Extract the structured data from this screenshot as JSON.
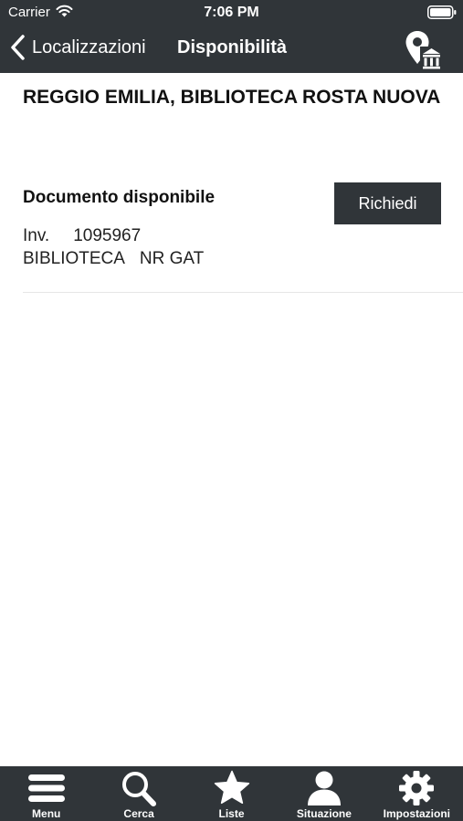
{
  "status_bar": {
    "carrier": "Carrier",
    "time": "7:06 PM"
  },
  "nav": {
    "back_label": "Localizzazioni",
    "title": "Disponibilità",
    "right_icon": "map-pin-library-icon"
  },
  "detail": {
    "library_name": "REGGIO EMILIA, BIBLIOTECA ROSTA NUOVA",
    "availability": "Documento disponibile",
    "inventory_label": "Inv.",
    "inventory_number": "1095967",
    "section": "BIBLIOTECA",
    "collocation": "NR GAT",
    "request_label": "Richiedi"
  },
  "tabs": [
    {
      "label": "Menu",
      "icon": "hamburger-menu-icon"
    },
    {
      "label": "Cerca",
      "icon": "search-icon"
    },
    {
      "label": "Liste",
      "icon": "star-icon"
    },
    {
      "label": "Situazione",
      "icon": "user-icon"
    },
    {
      "label": "Impostazioni",
      "icon": "gear-icon"
    }
  ],
  "colors": {
    "bar_background": "#303539",
    "bar_text": "#ffffff",
    "content_background": "#ffffff",
    "divider": "#e6e6e6"
  }
}
